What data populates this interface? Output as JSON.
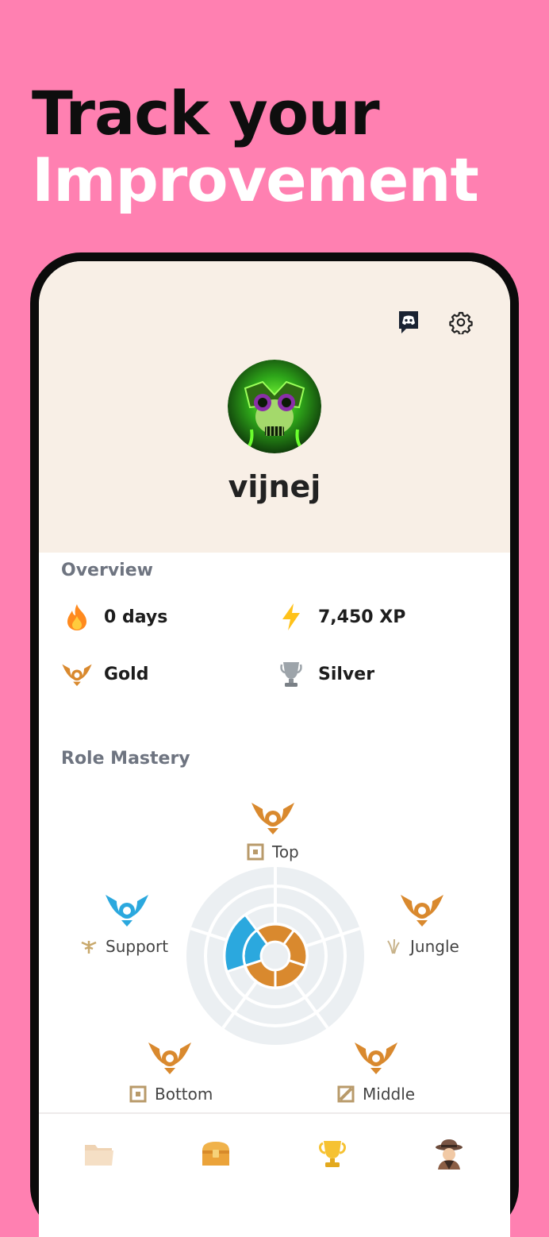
{
  "headline": {
    "line1": "Track your",
    "line2": "Improvement"
  },
  "header": {
    "discord_icon": "discord-icon",
    "settings_icon": "gear-icon"
  },
  "profile": {
    "username": "vijnej",
    "avatar_icon": "green-skull-avatar"
  },
  "overview": {
    "title": "Overview",
    "streak": {
      "icon": "flame-icon",
      "value": "0 days"
    },
    "xp": {
      "icon": "lightning-icon",
      "value": "7,450 XP"
    },
    "rank": {
      "icon": "gold-wings-badge-icon",
      "value": "Gold"
    },
    "league": {
      "icon": "silver-trophy-icon",
      "value": "Silver"
    }
  },
  "role_mastery": {
    "title": "Role Mastery",
    "roles": [
      {
        "name": "Top",
        "badge": "gold-wings-badge-icon",
        "icon": "top-lane-icon"
      },
      {
        "name": "Jungle",
        "badge": "gold-wings-badge-icon",
        "icon": "jungle-icon"
      },
      {
        "name": "Middle",
        "badge": "gold-wings-badge-icon",
        "icon": "middle-lane-icon"
      },
      {
        "name": "Bottom",
        "badge": "gold-wings-badge-icon",
        "icon": "bottom-lane-icon"
      },
      {
        "name": "Support",
        "badge": "blue-wings-badge-icon",
        "icon": "support-icon"
      }
    ]
  },
  "colors": {
    "background": "#FF80B1",
    "header_bg": "#F8EFE6",
    "gold": "#D9892E",
    "blue": "#2BA8DE"
  },
  "tabbar": [
    "folder-icon",
    "treasure-chest-icon",
    "trophy-icon",
    "detective-icon"
  ]
}
